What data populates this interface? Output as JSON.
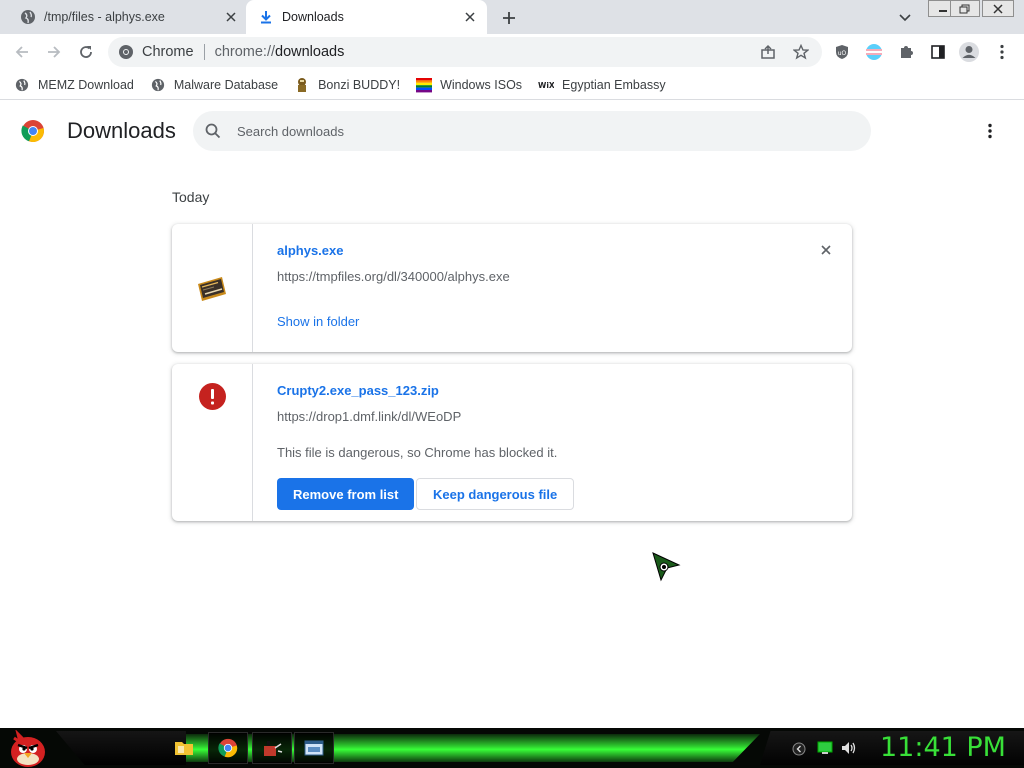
{
  "tabs": [
    {
      "title": "/tmp/files - alphys.exe",
      "active": false
    },
    {
      "title": "Downloads",
      "active": true
    }
  ],
  "toolbar": {
    "omnibox_origin": "Chrome",
    "omnibox_scheme": "chrome://",
    "omnibox_host": "downloads"
  },
  "bookmarks": [
    {
      "label": "MEMZ Download",
      "icon": "globe-icon"
    },
    {
      "label": "Malware Database",
      "icon": "globe-icon"
    },
    {
      "label": "Bonzi BUDDY!",
      "icon": "bonzi-icon"
    },
    {
      "label": "Windows ISOs",
      "icon": "windows-flag-icon"
    },
    {
      "label": "Egyptian Embassy",
      "icon": "wix-icon"
    }
  ],
  "downloads_page": {
    "title": "Downloads",
    "search_placeholder": "Search downloads",
    "section_label": "Today"
  },
  "downloads": [
    {
      "file_name": "alphys.exe",
      "url": "https://tmpfiles.org/dl/340000/alphys.exe",
      "action_label": "Show in folder",
      "icon": "exe-file-icon"
    },
    {
      "file_name": "Crupty2.exe_pass_123.zip",
      "url": "https://drop1.dmf.link/dl/WEoDP",
      "warning": "This file is dangerous, so Chrome has blocked it.",
      "remove_label": "Remove from list",
      "keep_label": "Keep dangerous file",
      "icon": "danger-icon"
    }
  ],
  "taskbar": {
    "clock": "11:41 PM"
  },
  "colors": {
    "accent": "#1a73e8",
    "danger": "#c5221f",
    "taskbar_green": "#38e038"
  }
}
